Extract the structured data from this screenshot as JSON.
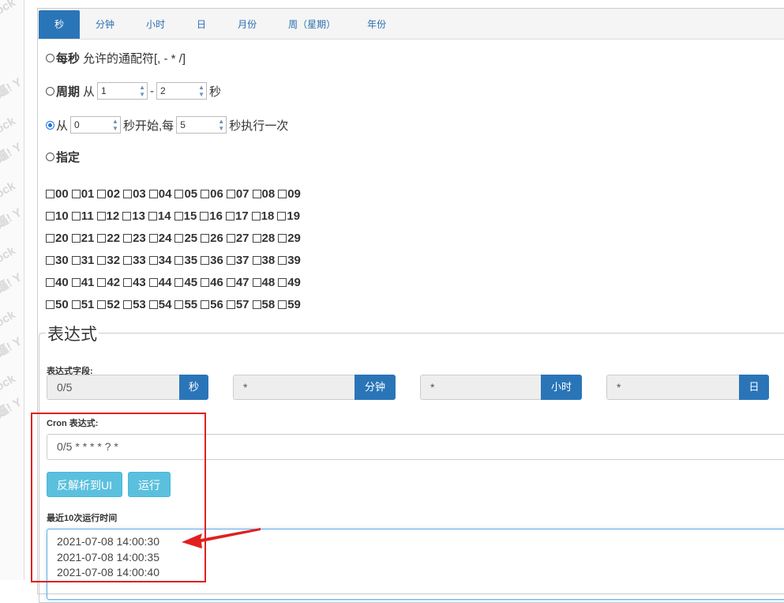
{
  "tabs": [
    {
      "label": "秒",
      "active": true
    },
    {
      "label": "分钟",
      "active": false
    },
    {
      "label": "小时",
      "active": false
    },
    {
      "label": "日",
      "active": false
    },
    {
      "label": "月份",
      "active": false
    },
    {
      "label": "周（星期）",
      "active": false
    },
    {
      "label": "年份",
      "active": false
    }
  ],
  "opt_every": {
    "title": "每秒",
    "desc": "允许的通配符[, - * /]"
  },
  "opt_cycle": {
    "title": "周期",
    "from_label": "从",
    "from": "1",
    "dash": "-",
    "to": "2",
    "unit": "秒"
  },
  "opt_start": {
    "from_label": "从",
    "start": "0",
    "mid_label": "秒开始,每",
    "step": "5",
    "tail": "秒执行一次"
  },
  "opt_specify": {
    "title": "指定"
  },
  "seconds": [
    [
      "00",
      "01",
      "02",
      "03",
      "04",
      "05",
      "06",
      "07",
      "08",
      "09"
    ],
    [
      "10",
      "11",
      "12",
      "13",
      "14",
      "15",
      "16",
      "17",
      "18",
      "19"
    ],
    [
      "20",
      "21",
      "22",
      "23",
      "24",
      "25",
      "26",
      "27",
      "28",
      "29"
    ],
    [
      "30",
      "31",
      "32",
      "33",
      "34",
      "35",
      "36",
      "37",
      "38",
      "39"
    ],
    [
      "40",
      "41",
      "42",
      "43",
      "44",
      "45",
      "46",
      "47",
      "48",
      "49"
    ],
    [
      "50",
      "51",
      "52",
      "53",
      "54",
      "55",
      "56",
      "57",
      "58",
      "59"
    ]
  ],
  "expression": {
    "legend": "表达式",
    "fields_label": "表达式字段:",
    "fields": [
      {
        "value": "0/5",
        "unit": "秒"
      },
      {
        "value": "*",
        "unit": "分钟"
      },
      {
        "value": "*",
        "unit": "小时"
      },
      {
        "value": "*",
        "unit": "日"
      }
    ],
    "cron_label": "Cron 表达式:",
    "cron_value": "0/5 * * * * ? *",
    "reverse_button": "反解析到UI",
    "run_button": "运行",
    "recent_label": "最近10次运行时间",
    "recent": [
      "2021-07-08 14:00:30",
      "2021-07-08 14:00:35",
      "2021-07-08 14:00:40"
    ]
  },
  "colors": {
    "accent": "#2a75b8",
    "info_button": "#5bc0de",
    "annotation": "#e02020"
  }
}
